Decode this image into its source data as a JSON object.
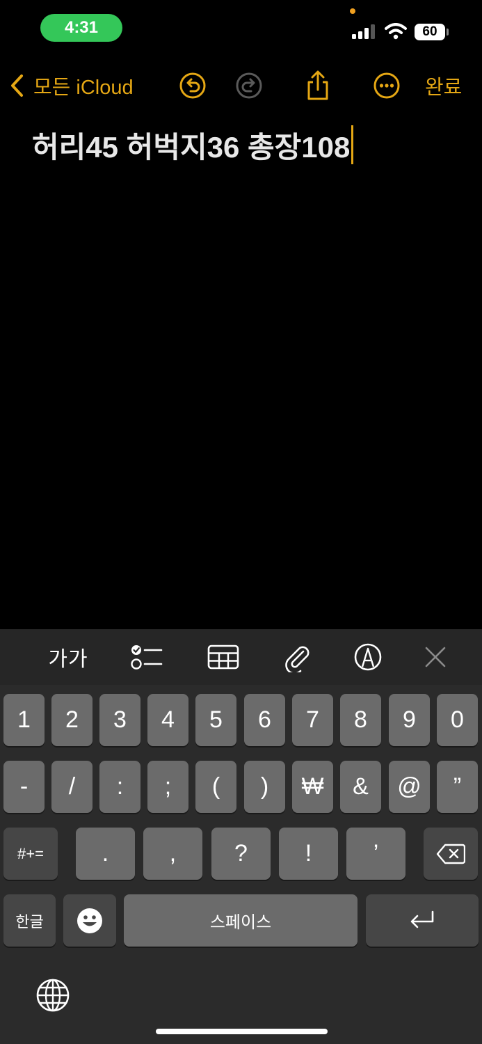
{
  "status": {
    "time": "4:31",
    "battery": "60"
  },
  "nav": {
    "back_label": "모든 iCloud",
    "done_label": "완료",
    "icons": [
      "chevron-left-icon",
      "undo-icon",
      "redo-icon",
      "share-icon",
      "more-icon"
    ]
  },
  "note": {
    "text": "허리45 허벅지36 총장108"
  },
  "toolbar": {
    "format_label": "가가",
    "icons": [
      "checklist-icon",
      "table-icon",
      "attachment-icon",
      "markup-icon",
      "close-icon"
    ]
  },
  "keyboard": {
    "row1": [
      "1",
      "2",
      "3",
      "4",
      "5",
      "6",
      "7",
      "8",
      "9",
      "0"
    ],
    "row2": [
      "-",
      "/",
      ":",
      ";",
      "(",
      ")",
      "₩",
      "&",
      "@",
      "”"
    ],
    "row3_shift": "#+=",
    "row3": [
      ".",
      ",",
      "?",
      "!",
      "’"
    ],
    "lang_key": "한글",
    "space_key": "스페이스",
    "icons": [
      "delete-icon",
      "emoji-icon",
      "return-icon",
      "globe-icon"
    ]
  },
  "colors": {
    "accent": "#e5a714",
    "time_pill": "#34c759",
    "key": "#6b6b6b",
    "key_dark": "#464646",
    "keyboard_bg": "#2b2b2b"
  }
}
